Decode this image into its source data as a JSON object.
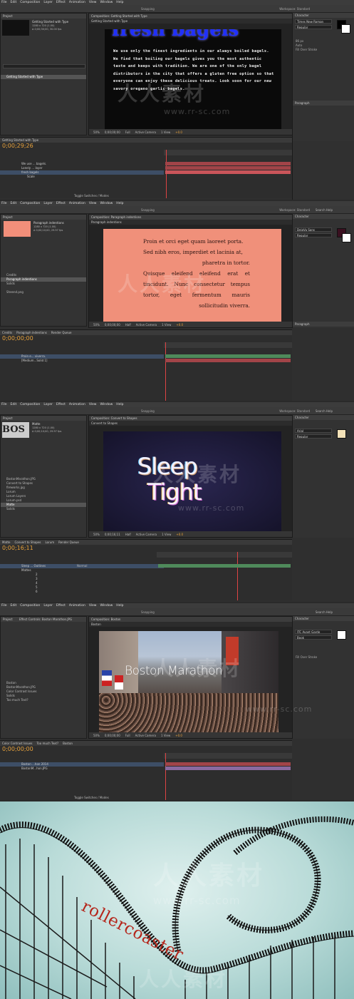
{
  "menu": [
    "File",
    "Edit",
    "Composition",
    "Layer",
    "Effect",
    "Animation",
    "View",
    "Window",
    "Help"
  ],
  "toolbar": {
    "snapping": "Snapping",
    "workspace_label": "Workspace:",
    "workspace": "Standard",
    "search": "Search Help"
  },
  "s1": {
    "project_tab": "Project",
    "comp_name": "Getting Started with Type",
    "comp_info1": "1280 x 720 (1.00)",
    "comp_info2": "Δ 0;00;30;00, 30.00 fps",
    "proj_item": "Getting Started with Type",
    "viewer_tab": "Composition: Getting Started with Type",
    "viewer_sub": "Getting Started with Type",
    "heading": "fresh bagels",
    "body": "We use only the finest ingredients in our always boiled bagels. We find that boiling our bagels gives you the most authentic taste and keeps with tradition. We are one of the only bagel distributors in the city that offers a gluten free option so that everyone can enjoy these delicious treats. Look soon for our new savory oregano garlic bagels.",
    "footer": [
      "50%",
      "0;00;00;00",
      "Full",
      "Active Camera",
      "1 View",
      "+0.0"
    ],
    "tl_tab": "Getting Started with Type",
    "timecode": "0;00;29;26",
    "layers": [
      "We use ... bagels.",
      "Lonely ... layer",
      "fresh bagels",
      "Scale"
    ],
    "char_tab": "Character",
    "font": "Times New Roman",
    "style": "Regular",
    "size": "86 px",
    "size2": "Auto",
    "stroke": "Fill Over Stroke",
    "para_tab": "Paragraph",
    "toggle": "Toggle Switches / Modes"
  },
  "s2": {
    "project_tab": "Project",
    "comp_name": "Paragraph indentions",
    "comp_info1": "1280 x 720 (1.00)",
    "comp_info2": "Δ 0;00;10;00, 29.97 fps",
    "proj_items": [
      "Credits",
      "Paragraph indentions",
      "Solids",
      "Sheend.png"
    ],
    "viewer_tab": "Composition: Paragraph indentions",
    "viewer_sub": "Paragraph indentions",
    "para_lines": [
      "Proin et orci eget quam laoreet porta.",
      "Sed nibh eros, imperdiet et lacinia at,",
      "pharetra in tortor.",
      "Quisque eleifend eleifend erat et",
      "tincidunt. Nunc consectetur tempus",
      "tortor, eget fermentum mauris",
      "sollicitudin viverra."
    ],
    "footer": [
      "50%",
      "0;00;00;00",
      "Half",
      "Active Camera",
      "1 View",
      "+0.0"
    ],
    "tl_tabs": [
      "Credits",
      "Paragraph indentions",
      "Render Queue"
    ],
    "timecode": "0;00;00;00",
    "layers": [
      "Proin e... viverra.",
      "[Medium...Solid 1]"
    ],
    "font": "DejaVu Sans",
    "style": "Regular",
    "toggle": "Toggle Switches / Modes"
  },
  "s3": {
    "project_tab": "Project",
    "comp_name": "Matte",
    "comp_info1": "1280 x 720 (1.00)",
    "comp_info2": "Δ 0;00;10;00, 29.97 fps",
    "thumb_text": "BOS",
    "proj_items": [
      "BostonMarathon.JPG",
      "Convert to Shapes",
      "fireworks.jpg",
      "Lorum",
      "Lorum Layers",
      "Lorum.psd",
      "Matte",
      "Solids"
    ],
    "viewer_tab": "Composition: Convert to Shapes",
    "viewer_sub": "Convert to Shapes",
    "word1": "Sleep",
    "word2": "Tight",
    "footer": [
      "50%",
      "0;00;16;11",
      "Half",
      "Active Camera",
      "1 View",
      "+0.0"
    ],
    "tl_tabs": [
      "Matte",
      "Convert to Shapes",
      "Lorum",
      "Render Queue"
    ],
    "timecode": "0;00;16;11",
    "layers": [
      "Sleep ... Outlines",
      "Mattes",
      "2",
      "3",
      "4",
      "5",
      "6"
    ],
    "mode": "Normal",
    "font": "Arial",
    "style": "Regular",
    "toggle": "Toggle Switches / Modes"
  },
  "s4": {
    "project_tab": "Project",
    "effect_tab": "Effect Controls: Boston Marathon.JPG",
    "proj_items": [
      "Boston",
      "BostonMarathon.JPG",
      "Color Contrast Issues",
      "Solids",
      "Too much Text?"
    ],
    "viewer_tab": "Composition: Boston",
    "viewer_sub": "Boston",
    "title": "Boston Marathon",
    "footer": [
      "50%",
      "0;00;00;00",
      "Full",
      "Active Camera",
      "1 View",
      "+0.0"
    ],
    "tl_tabs": [
      "Color Contrast Issues",
      "Too much Text?",
      "Boston"
    ],
    "timecode": "0;00;00;00",
    "layers": [
      "Boston ...hon 2014",
      "BostonM...hon.JPG"
    ],
    "font": "ITC Avant Garde",
    "style": "Book",
    "toggle": "Toggle Switches / Modes"
  },
  "s5": {
    "word": "rollercoaster"
  },
  "watermark": {
    "cn": "人人素材",
    "url": "www.rr-sc.com"
  }
}
